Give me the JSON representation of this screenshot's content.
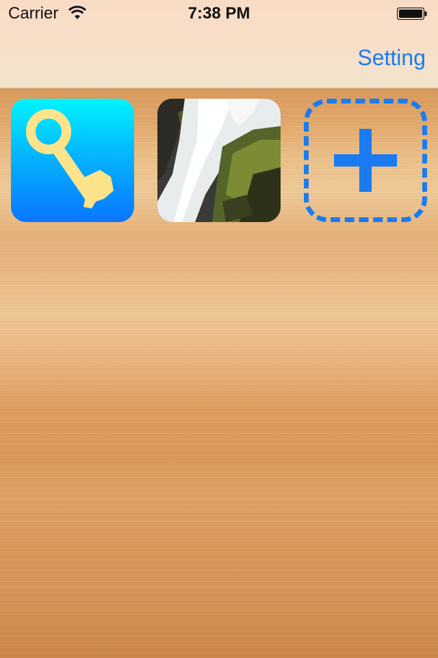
{
  "status_bar": {
    "carrier": "Carrier",
    "time": "7:38 PM"
  },
  "nav": {
    "setting_label": "Setting"
  },
  "tiles": [
    {
      "name": "key-app",
      "icon": "key-icon"
    },
    {
      "name": "waterfall-photo",
      "icon": "waterfall-photo"
    },
    {
      "name": "add-new",
      "icon": "plus-icon"
    }
  ],
  "colors": {
    "accent": "#1A7CF0",
    "key_tile_top": "#00F4FF",
    "key_tile_bottom": "#0A76FF",
    "key_color": "#FDE38A"
  }
}
